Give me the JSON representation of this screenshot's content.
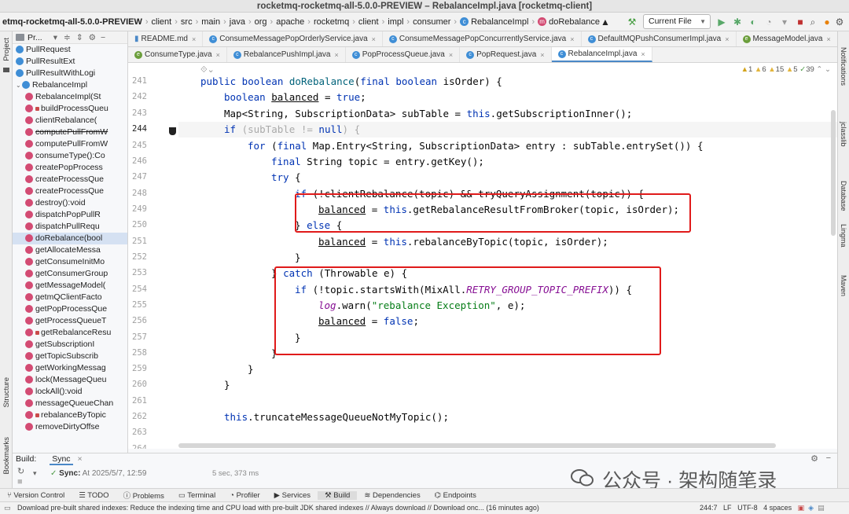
{
  "window_title": "rocketmq-rocketmq-all-5.0.0-PREVIEW – RebalanceImpl.java [rocketmq-client]",
  "breadcrumb": [
    "etmq-rocketmq-all-5.0.0-PREVIEW",
    "client",
    "src",
    "main",
    "java",
    "org",
    "apache",
    "rocketmq",
    "client",
    "impl",
    "consumer",
    "RebalanceImpl",
    "doRebalance"
  ],
  "run_config": "Current File",
  "project_panel": {
    "title": "Pr...",
    "items": [
      {
        "label": "PullRequest",
        "icon": "class"
      },
      {
        "label": "PullResultExt",
        "icon": "class"
      },
      {
        "label": "PullResultWithLogi",
        "icon": "class"
      },
      {
        "label": "RebalanceImpl",
        "icon": "class"
      },
      {
        "label": "RebalanceImpl(St",
        "icon": "method"
      },
      {
        "label": "buildProcessQueu",
        "icon": "method",
        "lock": true
      },
      {
        "label": "clientRebalance(",
        "icon": "method"
      },
      {
        "label": "computePullFromW",
        "icon": "method",
        "strike": true
      },
      {
        "label": "computePullFromW",
        "icon": "method"
      },
      {
        "label": "consumeType():Co",
        "icon": "method"
      },
      {
        "label": "createPopProcess",
        "icon": "method"
      },
      {
        "label": "createProcessQue",
        "icon": "method"
      },
      {
        "label": "createProcessQue",
        "icon": "method"
      },
      {
        "label": "destroy():void",
        "icon": "method"
      },
      {
        "label": "dispatchPopPullR",
        "icon": "method"
      },
      {
        "label": "dispatchPullRequ",
        "icon": "method"
      },
      {
        "label": "doRebalance(bool",
        "icon": "method",
        "selected": true
      },
      {
        "label": "getAllocateMessa",
        "icon": "method"
      },
      {
        "label": "getConsumeInitMo",
        "icon": "method"
      },
      {
        "label": "getConsumerGroup",
        "icon": "method"
      },
      {
        "label": "getMessageModel(",
        "icon": "method"
      },
      {
        "label": "getmQClientFacto",
        "icon": "method"
      },
      {
        "label": "getPopProcessQue",
        "icon": "method"
      },
      {
        "label": "getProcessQueueT",
        "icon": "method"
      },
      {
        "label": "getRebalanceResu",
        "icon": "method",
        "lock": true
      },
      {
        "label": "getSubscriptionI",
        "icon": "method"
      },
      {
        "label": "getTopicSubscrib",
        "icon": "method"
      },
      {
        "label": "getWorkingMessag",
        "icon": "method"
      },
      {
        "label": "lock(MessageQueu",
        "icon": "method"
      },
      {
        "label": "lockAll():void",
        "icon": "method"
      },
      {
        "label": "messageQueueChan",
        "icon": "method"
      },
      {
        "label": "rebalanceByTopic",
        "icon": "method",
        "lock": true
      },
      {
        "label": "removeDirtyOffse",
        "icon": "method"
      }
    ]
  },
  "tabs_row1": [
    "README.md",
    "ConsumeMessagePopOrderlyService.java",
    "ConsumeMessagePopConcurrentlyService.java",
    "DefaultMQPushConsumerImpl.java",
    "MessageModel.java"
  ],
  "tabs_row2": [
    "ConsumeType.java",
    "RebalancePushImpl.java",
    "PopProcessQueue.java",
    "PopRequest.java",
    "RebalanceImpl.java"
  ],
  "active_tab": "RebalanceImpl.java",
  "inspections": {
    "warnings": "1",
    "weak": "6",
    "typos": "15",
    "info": "5",
    "ok": "39"
  },
  "line_numbers": [
    "241",
    "242",
    "243",
    "244",
    "245",
    "246",
    "247",
    "248",
    "249",
    "250",
    "251",
    "252",
    "253",
    "254",
    "255",
    "256",
    "257",
    "258",
    "259",
    "260",
    "261",
    "262",
    "263",
    "264"
  ],
  "code": {
    "l241_a": "public boolean ",
    "l241_fn": "doRebalance",
    "l241_b": "(",
    "l241_kw": "final boolean ",
    "l241_c": "isOrder) {",
    "l242_kw": "boolean ",
    "l242_var": "balanced",
    "l242_a": " = ",
    "l242_kw2": "true",
    "l242_b": ";",
    "l243_a": "Map<String, SubscriptionData> subTable = ",
    "l243_kw": "this",
    "l243_b": ".getSubscriptionInner();",
    "l244_kw": "if ",
    "l244_a": "(subTable != ",
    "l244_kw2": "null",
    "l244_b": ") {",
    "l245_kw": "for ",
    "l245_a": "(",
    "l245_kw2": "final ",
    "l245_b": "Map.Entry<String, SubscriptionData> entry : subTable.entrySet()) {",
    "l246_kw": "final ",
    "l246_a": "String topic = entry.getKey();",
    "l247_kw": "try ",
    "l247_a": "{",
    "l248_kw": "if ",
    "l248_a": "(!clientRebalance(topic) && tryQueryAssignment(topic)) {",
    "l249_var": "balanced",
    "l249_a": " = ",
    "l249_kw": "this",
    "l249_b": ".getRebalanceResultFromBroker(topic, isOrder);",
    "l250_a": "} ",
    "l250_kw": "else ",
    "l250_b": "{",
    "l251_var": "balanced",
    "l251_a": " = ",
    "l251_kw": "this",
    "l251_b": ".rebalanceByTopic(topic, isOrder);",
    "l252_a": "}",
    "l253_a": "} ",
    "l253_kw": "catch ",
    "l253_b": "(Throwable e) {",
    "l254_kw": "if ",
    "l254_a": "(!topic.startsWith(MixAll.",
    "l254_stat": "RETRY_GROUP_TOPIC_PREFIX",
    "l254_b": ")) {",
    "l255_fld": "log",
    "l255_a": ".warn(",
    "l255_str": "\"rebalance Exception\"",
    "l255_b": ", e);",
    "l256_var": "balanced",
    "l256_a": " = ",
    "l256_kw": "false",
    "l256_b": ";",
    "l257_a": "}",
    "l258_a": "}",
    "l259_a": "}",
    "l260_a": "}",
    "l262_kw": "this",
    "l262_a": ".truncateMessageQueueNotMyTopic();"
  },
  "build": {
    "tab_build": "Build:",
    "tab_sync": "Sync",
    "sync_label": "Sync:",
    "sync_time": "At 2025/5/7, 12:59",
    "duration": "5 sec, 373 ms"
  },
  "tool_windows": [
    "Version Control",
    "TODO",
    "Problems",
    "Terminal",
    "Profiler",
    "Services",
    "Build",
    "Dependencies",
    "Endpoints"
  ],
  "active_tool": "Build",
  "status": {
    "message": "Download pre-built shared indexes: Reduce the indexing time and CPU load with pre-built JDK shared indexes // Always download // Download onc... (16 minutes ago)",
    "position": "244:7",
    "line_sep": "LF",
    "encoding": "UTF-8",
    "indent": "4 spaces"
  },
  "left_stripe": [
    "Project",
    "Structure",
    "Bookmarks"
  ],
  "right_stripe": [
    "Notifications",
    "jclasslib",
    "Database",
    "Lingma",
    "Maven"
  ],
  "watermark": "公众号 · 架构随笔录"
}
